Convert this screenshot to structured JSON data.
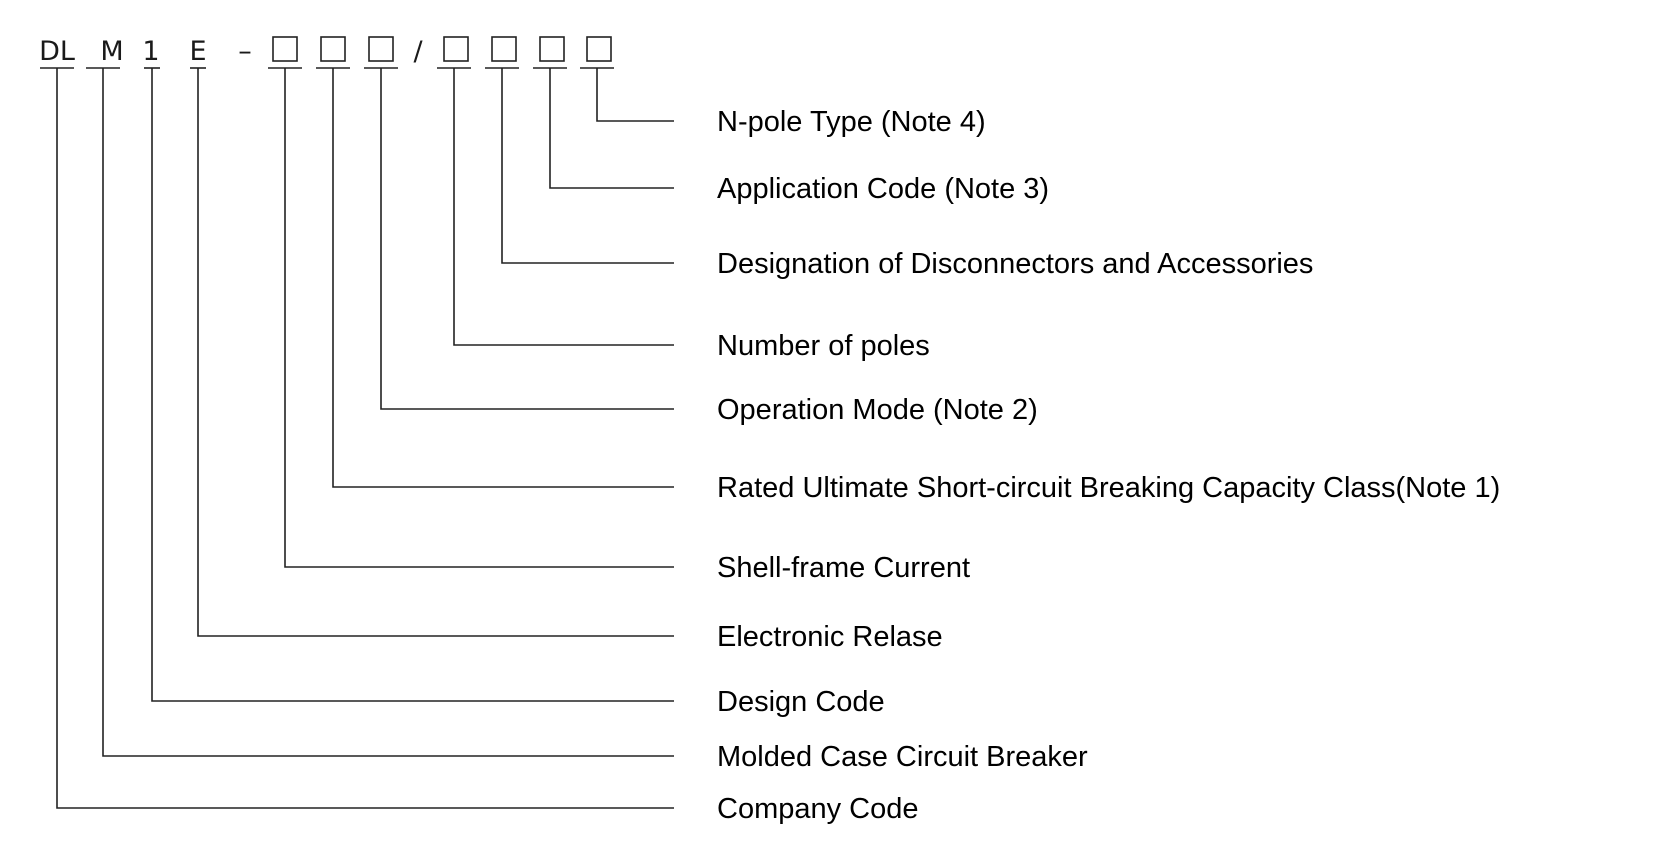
{
  "code": {
    "segments": [
      "DL",
      "M",
      "1",
      "E",
      "–",
      "□",
      "□",
      "□",
      "/",
      "□",
      "□",
      "□",
      "□"
    ]
  },
  "labels": [
    "N-pole Type (Note 4)",
    "Application Code (Note 3)",
    "Designation of Disconnectors and Accessories",
    "Number of poles",
    "Operation Mode (Note 2)",
    "Rated Ultimate Short-circuit Breaking Capacity Class(Note 1)",
    "Shell-frame Current",
    "Electronic Relase",
    "Design Code",
    "Molded Case Circuit Breaker",
    "Company Code"
  ]
}
